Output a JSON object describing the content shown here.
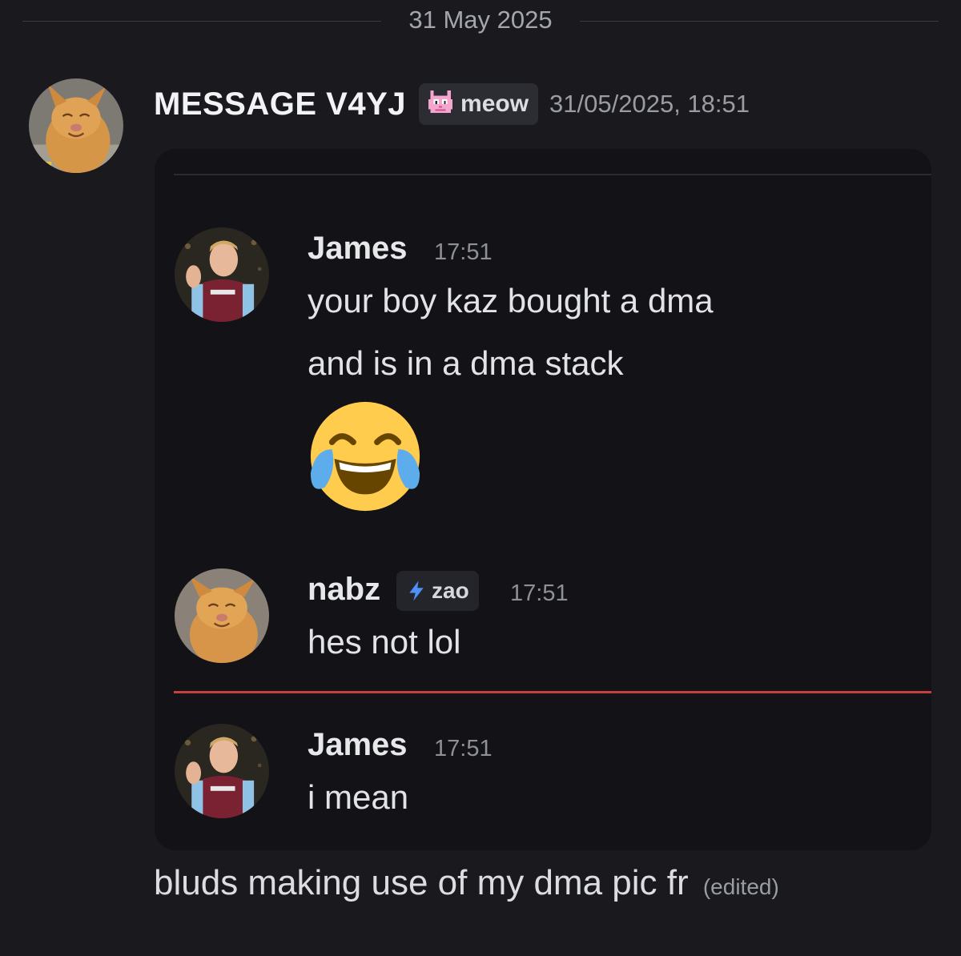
{
  "date_divider": "31 May 2025",
  "post": {
    "author": "MESSAGE V4YJ",
    "tag_icon": "pixel-cat-icon",
    "tag_label": "meow",
    "timestamp": "31/05/2025, 18:51",
    "caption": "bluds making use of my dma pic fr",
    "edited_label": "(edited)"
  },
  "embedded_chat": {
    "messages": [
      {
        "author": "James",
        "time": "17:51",
        "lines": [
          "your boy kaz bought a dma",
          "and is in a dma stack"
        ],
        "emoji": "face-with-tears-of-joy-icon"
      },
      {
        "author": "nabz",
        "clan_icon": "lightning-bolt-icon",
        "clan_tag": "zao",
        "time": "17:51",
        "lines": [
          "hes not lol"
        ]
      },
      {
        "author": "James",
        "time": "17:51",
        "lines": [
          "i mean"
        ]
      }
    ]
  },
  "colors": {
    "background": "#1a1a1e",
    "embed_background": "#131317",
    "new_messages_divider": "#c8403d",
    "clan_bolt": "#4f8ff7"
  }
}
